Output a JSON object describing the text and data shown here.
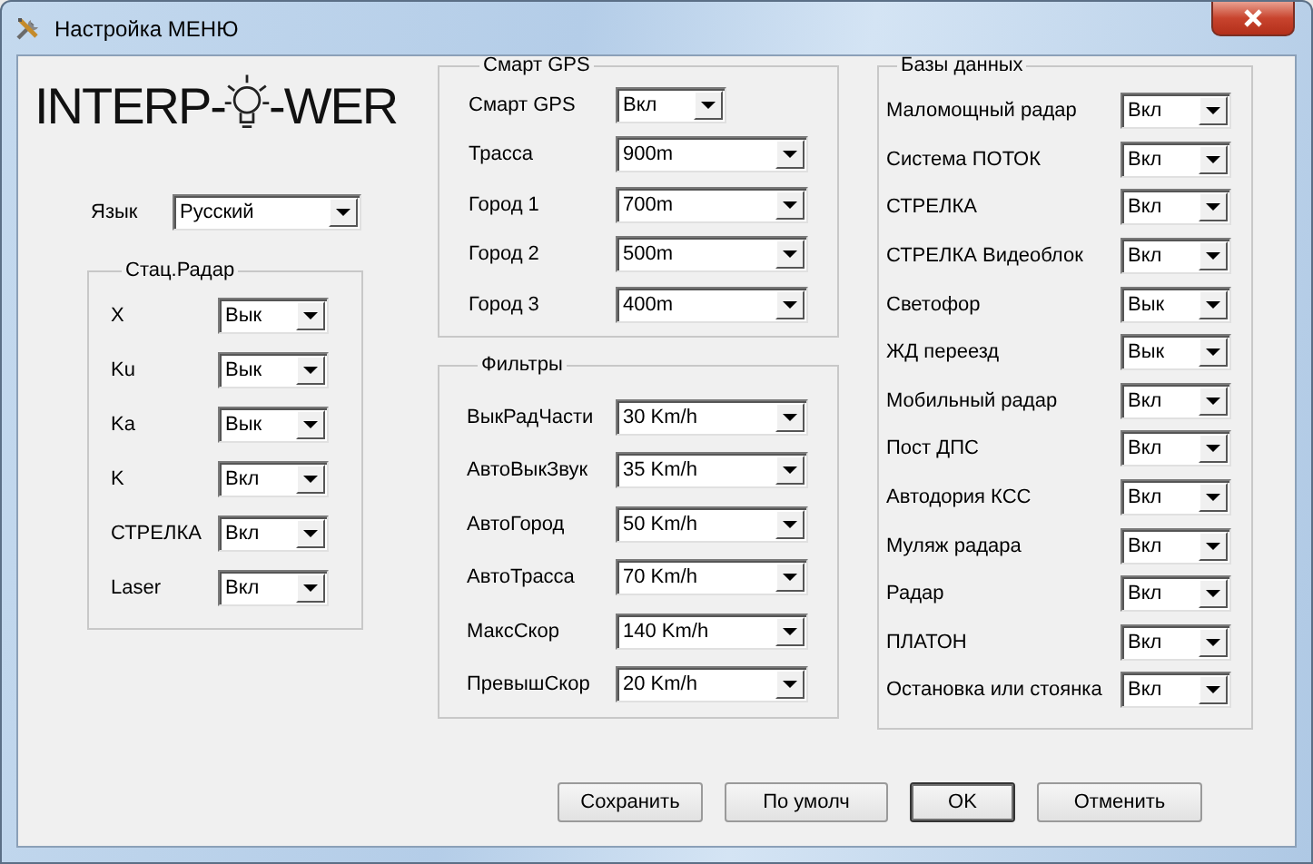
{
  "window": {
    "title": "Настройка МЕНЮ"
  },
  "logo": {
    "before": "INTERP-",
    "after": "-WER"
  },
  "language": {
    "label": "Язык",
    "value": "Русский"
  },
  "groups": [
    {
      "title": "Стац.Радар",
      "rows": [
        {
          "label": "X",
          "value": "Вык"
        },
        {
          "label": "Ku",
          "value": "Вык"
        },
        {
          "label": "Ka",
          "value": "Вык"
        },
        {
          "label": "K",
          "value": "Вкл"
        },
        {
          "label": "СТРЕЛКА",
          "value": "Вкл"
        },
        {
          "label": "Laser",
          "value": "Вкл"
        }
      ]
    },
    {
      "title": "Смарт GPS",
      "rows": [
        {
          "label": "Смарт GPS",
          "value": "Вкл"
        },
        {
          "label": "Трасса",
          "value": "900m"
        },
        {
          "label": "Город 1",
          "value": "700m"
        },
        {
          "label": "Город 2",
          "value": "500m"
        },
        {
          "label": "Город 3",
          "value": "400m"
        }
      ]
    },
    {
      "title": "Фильтры",
      "rows": [
        {
          "label": "ВыкРадЧасти",
          "value": "30 Km/h"
        },
        {
          "label": "АвтоВыкЗвук",
          "value": "35 Km/h"
        },
        {
          "label": "АвтоГород",
          "value": "50 Km/h"
        },
        {
          "label": "АвтоТрасса",
          "value": "70 Km/h"
        },
        {
          "label": "МаксСкор",
          "value": "140 Km/h"
        },
        {
          "label": "ПревышСкор",
          "value": "20 Km/h"
        }
      ]
    },
    {
      "title": "Базы данных",
      "rows": [
        {
          "label": "Маломощный радар",
          "value": "Вкл"
        },
        {
          "label": "Система ПОТОК",
          "value": "Вкл"
        },
        {
          "label": "СТРЕЛКА",
          "value": "Вкл"
        },
        {
          "label": "СТРЕЛКА Видеоблок",
          "value": "Вкл"
        },
        {
          "label": "Светофор",
          "value": "Вык"
        },
        {
          "label": "ЖД переезд",
          "value": "Вык"
        },
        {
          "label": "Мобильный радар",
          "value": "Вкл"
        },
        {
          "label": "Пост ДПС",
          "value": "Вкл"
        },
        {
          "label": "Автодория КСС",
          "value": "Вкл"
        },
        {
          "label": "Муляж радара",
          "value": "Вкл"
        },
        {
          "label": "Радар",
          "value": "Вкл"
        },
        {
          "label": "ПЛАТОН",
          "value": "Вкл"
        },
        {
          "label": "Остановка или стоянка",
          "value": "Вкл"
        }
      ]
    }
  ],
  "buttons": [
    {
      "label": "Сохранить",
      "default": false
    },
    {
      "label": "По умолч",
      "default": false
    },
    {
      "label": "OK",
      "default": true
    },
    {
      "label": "Отменить",
      "default": false
    }
  ]
}
